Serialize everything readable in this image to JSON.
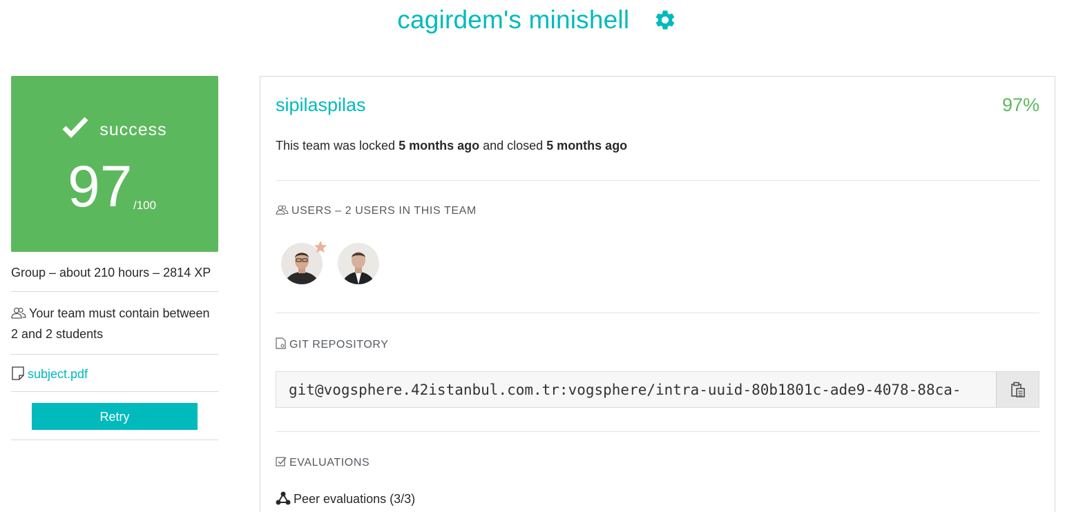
{
  "header": {
    "project_title": "cagirdem's minishell",
    "settings_icon": "gear-icon",
    "accent_color": "#00babc"
  },
  "score_card": {
    "status_label": "success",
    "score": "97",
    "max": "/100",
    "color": "#5cb85c"
  },
  "project_meta": {
    "summary": "Group – about 210 hours – 2814 XP",
    "team_size_text": "Your team must contain between 2 and 2 students",
    "subject_link": "subject.pdf",
    "retry_label": "Retry"
  },
  "team": {
    "name": "sipilaspilas",
    "percent": "97%",
    "lock_prefix": "This team was locked ",
    "locked_ago": "5 months ago",
    "lock_middle": " and closed ",
    "closed_ago": "5 months ago",
    "users_header": "USERS – 2 USERS IN THIS TEAM",
    "git_header": "GIT REPOSITORY",
    "git_url": "git@vogsphere.42istanbul.com.tr:vogsphere/intra-uuid-80b1801c-ade9-4078-88ca-",
    "evaluations_header": "EVALUATIONS",
    "peer_evaluations": "Peer evaluations (3/3)"
  }
}
